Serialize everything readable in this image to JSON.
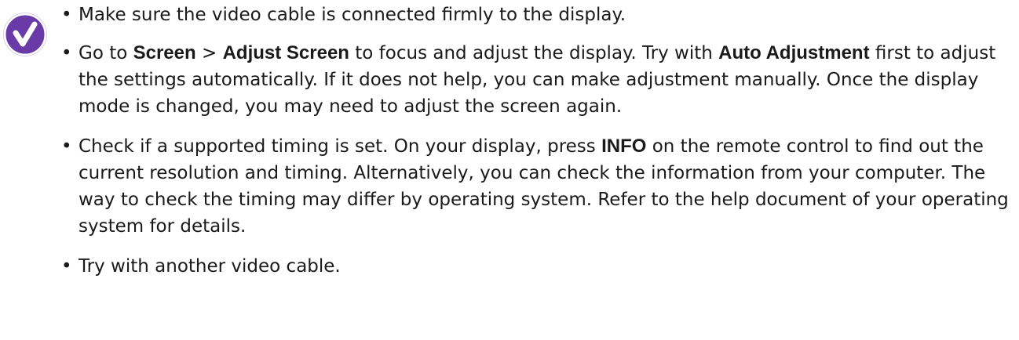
{
  "badge": {
    "icon": "checkmark-icon",
    "color": "#6a3aa8",
    "border_color": "#ffffff"
  },
  "tips": [
    {
      "text": "Make sure the video cable is connected firmly to the display."
    },
    {
      "t1": "Go to ",
      "k1": "Screen",
      "t2": " > ",
      "k2": "Adjust Screen",
      "t3": " to focus and adjust the display. Try with ",
      "k3": "Auto Adjustment",
      "t4": " first to adjust the settings automatically. If it does not help, you can make adjustment manually. Once the display mode is changed, you may need to adjust the screen again."
    },
    {
      "t1": "Check if a supported timing is set. On your display, press ",
      "k1": "INFO",
      "t2": " on the remote control to find out the current resolution and timing. Alternatively, you can check the information from your computer. The way to check the timing may differ by operating system. Refer to the help document of your operating system for details."
    },
    {
      "text": "Try with another video cable."
    }
  ]
}
